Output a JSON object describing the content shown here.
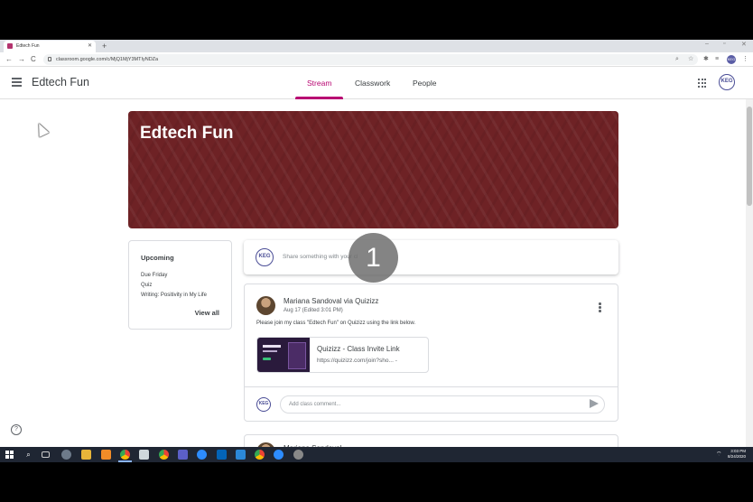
{
  "browser": {
    "tab_title": "Edtech Fun",
    "new_tab": "+",
    "url": "classroom.google.com/c/MjQ1MjY3MTIyNDZa",
    "nav": {
      "back": "←",
      "forward": "→",
      "reload": "C"
    },
    "window_controls": {
      "minimize": "–",
      "maximize": "▫",
      "close": "✕"
    }
  },
  "header": {
    "class_name": "Edtech Fun",
    "tabs": [
      {
        "label": "Stream",
        "active": true
      },
      {
        "label": "Classwork",
        "active": false
      },
      {
        "label": "People",
        "active": false
      }
    ],
    "avatar_initials": "KEG"
  },
  "banner": {
    "title": "Edtech Fun",
    "color": "#6e2225"
  },
  "upcoming": {
    "title": "Upcoming",
    "lines": [
      "Due Friday",
      "Quiz",
      "Writing: Positivity in My Life"
    ],
    "view_all": "View all"
  },
  "share": {
    "placeholder": "Share something with your class...",
    "visible_text": "Share something with your cl"
  },
  "overlay_badge": "1",
  "post": {
    "author": "Mariana Sandoval via Quizizz",
    "date": "Aug 17 (Edited 3:01 PM)",
    "body": "Please join my class \"Edtech Fun\" on Quizizz using the link below.",
    "attachment": {
      "title": "Quizizz - Class Invite Link",
      "url": "https://quizizz.com/join?sho... -"
    },
    "comment_placeholder": "Add class comment..."
  },
  "next_post": {
    "author": "Mariana Sandoval"
  },
  "help_icon": "?",
  "taskbar": {
    "time": "3:03 PM",
    "date": "8/24/2020"
  },
  "accent_color": "#b80672"
}
